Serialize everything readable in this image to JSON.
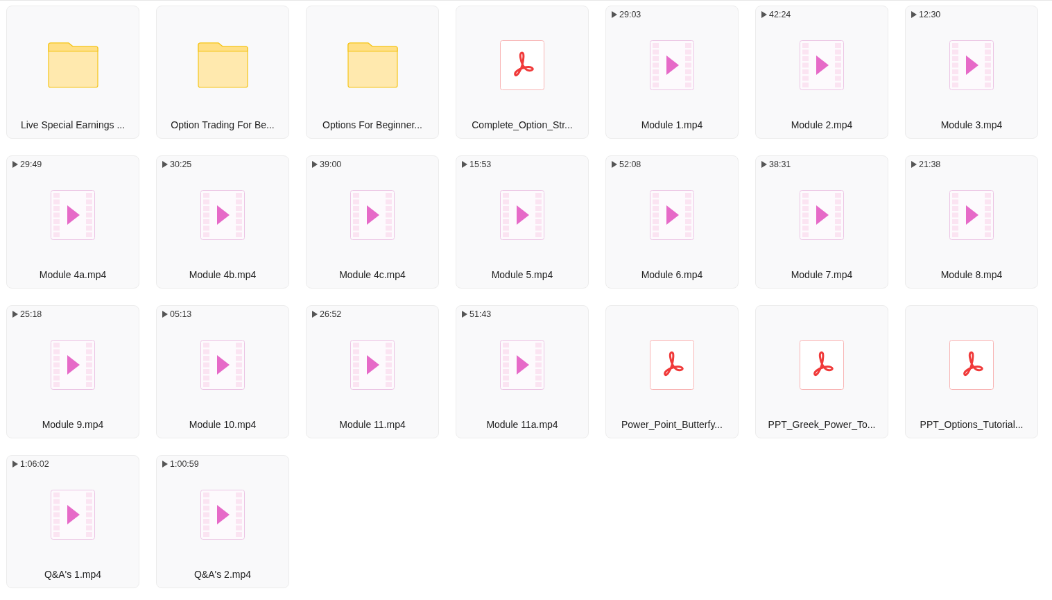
{
  "items": [
    {
      "kind": "folder",
      "name": "Live Special Earnings ..."
    },
    {
      "kind": "folder",
      "name": "Option Trading For Be..."
    },
    {
      "kind": "folder",
      "name": "Options For Beginner..."
    },
    {
      "kind": "pdf",
      "name": "Complete_Option_Str..."
    },
    {
      "kind": "video",
      "name": "Module 1.mp4",
      "duration": "29:03"
    },
    {
      "kind": "video",
      "name": "Module 2.mp4",
      "duration": "42:24"
    },
    {
      "kind": "video",
      "name": "Module 3.mp4",
      "duration": "12:30"
    },
    {
      "kind": "video",
      "name": "Module 4a.mp4",
      "duration": "29:49"
    },
    {
      "kind": "video",
      "name": "Module 4b.mp4",
      "duration": "30:25"
    },
    {
      "kind": "video",
      "name": "Module 4c.mp4",
      "duration": "39:00"
    },
    {
      "kind": "video",
      "name": "Module 5.mp4",
      "duration": "15:53"
    },
    {
      "kind": "video",
      "name": "Module 6.mp4",
      "duration": "52:08"
    },
    {
      "kind": "video",
      "name": "Module 7.mp4",
      "duration": "38:31"
    },
    {
      "kind": "video",
      "name": "Module 8.mp4",
      "duration": "21:38"
    },
    {
      "kind": "video",
      "name": "Module 9.mp4",
      "duration": "25:18"
    },
    {
      "kind": "video",
      "name": "Module 10.mp4",
      "duration": "05:13"
    },
    {
      "kind": "video",
      "name": "Module 11.mp4",
      "duration": "26:52"
    },
    {
      "kind": "video",
      "name": "Module 11a.mp4",
      "duration": "51:43"
    },
    {
      "kind": "pdf",
      "name": "Power_Point_Butterfy..."
    },
    {
      "kind": "pdf",
      "name": "PPT_Greek_Power_To..."
    },
    {
      "kind": "pdf",
      "name": "PPT_Options_Tutorial..."
    },
    {
      "kind": "video",
      "name": "Q&A's 1.mp4",
      "duration": "1:06:02"
    },
    {
      "kind": "video",
      "name": "Q&A's 2.mp4",
      "duration": "1:00:59"
    }
  ]
}
